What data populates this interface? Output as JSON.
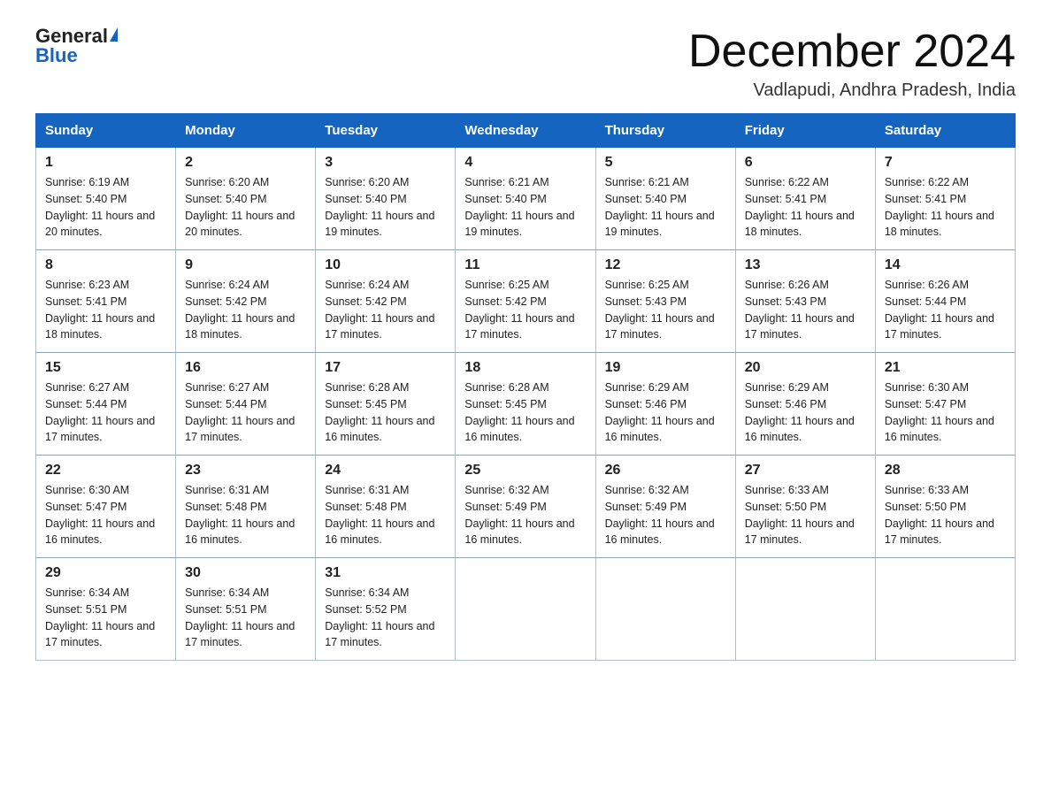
{
  "logo": {
    "general": "General",
    "blue": "Blue"
  },
  "title": "December 2024",
  "subtitle": "Vadlapudi, Andhra Pradesh, India",
  "days": [
    "Sunday",
    "Monday",
    "Tuesday",
    "Wednesday",
    "Thursday",
    "Friday",
    "Saturday"
  ],
  "weeks": [
    [
      {
        "num": "1",
        "sunrise": "6:19 AM",
        "sunset": "5:40 PM",
        "daylight": "11 hours and 20 minutes."
      },
      {
        "num": "2",
        "sunrise": "6:20 AM",
        "sunset": "5:40 PM",
        "daylight": "11 hours and 20 minutes."
      },
      {
        "num": "3",
        "sunrise": "6:20 AM",
        "sunset": "5:40 PM",
        "daylight": "11 hours and 19 minutes."
      },
      {
        "num": "4",
        "sunrise": "6:21 AM",
        "sunset": "5:40 PM",
        "daylight": "11 hours and 19 minutes."
      },
      {
        "num": "5",
        "sunrise": "6:21 AM",
        "sunset": "5:40 PM",
        "daylight": "11 hours and 19 minutes."
      },
      {
        "num": "6",
        "sunrise": "6:22 AM",
        "sunset": "5:41 PM",
        "daylight": "11 hours and 18 minutes."
      },
      {
        "num": "7",
        "sunrise": "6:22 AM",
        "sunset": "5:41 PM",
        "daylight": "11 hours and 18 minutes."
      }
    ],
    [
      {
        "num": "8",
        "sunrise": "6:23 AM",
        "sunset": "5:41 PM",
        "daylight": "11 hours and 18 minutes."
      },
      {
        "num": "9",
        "sunrise": "6:24 AM",
        "sunset": "5:42 PM",
        "daylight": "11 hours and 18 minutes."
      },
      {
        "num": "10",
        "sunrise": "6:24 AM",
        "sunset": "5:42 PM",
        "daylight": "11 hours and 17 minutes."
      },
      {
        "num": "11",
        "sunrise": "6:25 AM",
        "sunset": "5:42 PM",
        "daylight": "11 hours and 17 minutes."
      },
      {
        "num": "12",
        "sunrise": "6:25 AM",
        "sunset": "5:43 PM",
        "daylight": "11 hours and 17 minutes."
      },
      {
        "num": "13",
        "sunrise": "6:26 AM",
        "sunset": "5:43 PM",
        "daylight": "11 hours and 17 minutes."
      },
      {
        "num": "14",
        "sunrise": "6:26 AM",
        "sunset": "5:44 PM",
        "daylight": "11 hours and 17 minutes."
      }
    ],
    [
      {
        "num": "15",
        "sunrise": "6:27 AM",
        "sunset": "5:44 PM",
        "daylight": "11 hours and 17 minutes."
      },
      {
        "num": "16",
        "sunrise": "6:27 AM",
        "sunset": "5:44 PM",
        "daylight": "11 hours and 17 minutes."
      },
      {
        "num": "17",
        "sunrise": "6:28 AM",
        "sunset": "5:45 PM",
        "daylight": "11 hours and 16 minutes."
      },
      {
        "num": "18",
        "sunrise": "6:28 AM",
        "sunset": "5:45 PM",
        "daylight": "11 hours and 16 minutes."
      },
      {
        "num": "19",
        "sunrise": "6:29 AM",
        "sunset": "5:46 PM",
        "daylight": "11 hours and 16 minutes."
      },
      {
        "num": "20",
        "sunrise": "6:29 AM",
        "sunset": "5:46 PM",
        "daylight": "11 hours and 16 minutes."
      },
      {
        "num": "21",
        "sunrise": "6:30 AM",
        "sunset": "5:47 PM",
        "daylight": "11 hours and 16 minutes."
      }
    ],
    [
      {
        "num": "22",
        "sunrise": "6:30 AM",
        "sunset": "5:47 PM",
        "daylight": "11 hours and 16 minutes."
      },
      {
        "num": "23",
        "sunrise": "6:31 AM",
        "sunset": "5:48 PM",
        "daylight": "11 hours and 16 minutes."
      },
      {
        "num": "24",
        "sunrise": "6:31 AM",
        "sunset": "5:48 PM",
        "daylight": "11 hours and 16 minutes."
      },
      {
        "num": "25",
        "sunrise": "6:32 AM",
        "sunset": "5:49 PM",
        "daylight": "11 hours and 16 minutes."
      },
      {
        "num": "26",
        "sunrise": "6:32 AM",
        "sunset": "5:49 PM",
        "daylight": "11 hours and 16 minutes."
      },
      {
        "num": "27",
        "sunrise": "6:33 AM",
        "sunset": "5:50 PM",
        "daylight": "11 hours and 17 minutes."
      },
      {
        "num": "28",
        "sunrise": "6:33 AM",
        "sunset": "5:50 PM",
        "daylight": "11 hours and 17 minutes."
      }
    ],
    [
      {
        "num": "29",
        "sunrise": "6:34 AM",
        "sunset": "5:51 PM",
        "daylight": "11 hours and 17 minutes."
      },
      {
        "num": "30",
        "sunrise": "6:34 AM",
        "sunset": "5:51 PM",
        "daylight": "11 hours and 17 minutes."
      },
      {
        "num": "31",
        "sunrise": "6:34 AM",
        "sunset": "5:52 PM",
        "daylight": "11 hours and 17 minutes."
      },
      null,
      null,
      null,
      null
    ]
  ]
}
